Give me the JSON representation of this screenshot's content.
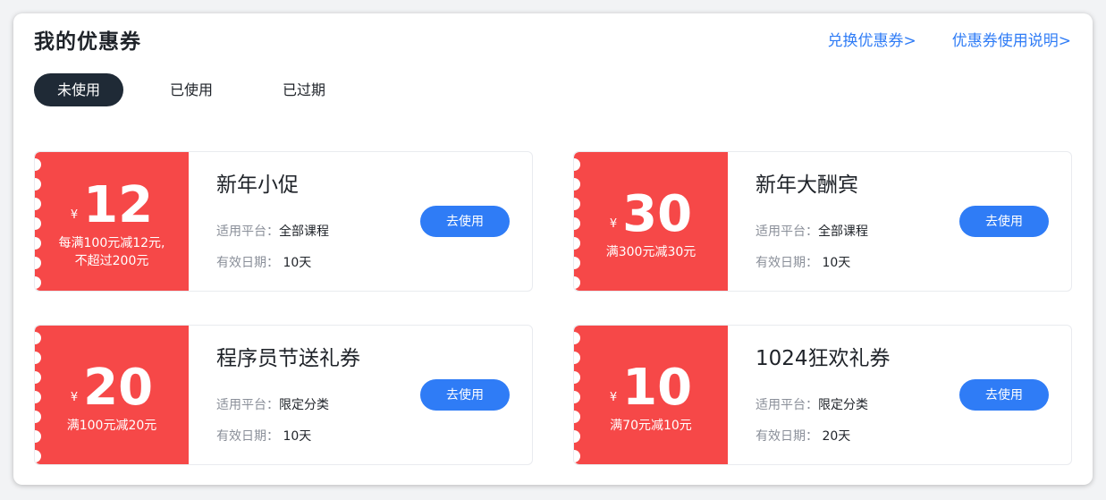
{
  "page": {
    "title": "我的优惠券",
    "links": {
      "redeem": "兑换优惠券>",
      "help": "优惠券使用说明>"
    }
  },
  "tabs": [
    {
      "label": "未使用",
      "active": true
    },
    {
      "label": "已使用",
      "active": false
    },
    {
      "label": "已过期",
      "active": false
    }
  ],
  "labels": {
    "platform": "适用平台：",
    "validity": "有效日期：",
    "currency": "¥",
    "use_button": "去使用"
  },
  "coupons": [
    {
      "name": "新年小促",
      "amount": "12",
      "rule_line1": "每满100元减12元,",
      "rule_line2": "不超过200元",
      "platform": "全部课程",
      "validity": "10天"
    },
    {
      "name": "新年大酬宾",
      "amount": "30",
      "rule_line1": "满300元减30元",
      "rule_line2": "",
      "platform": "全部课程",
      "validity": "10天"
    },
    {
      "name": "程序员节送礼券",
      "amount": "20",
      "rule_line1": "满100元减20元",
      "rule_line2": "",
      "platform": "限定分类",
      "validity": "10天"
    },
    {
      "name": "1024狂欢礼券",
      "amount": "10",
      "rule_line1": "满70元减10元",
      "rule_line2": "",
      "platform": "限定分类",
      "validity": "20天"
    }
  ],
  "colors": {
    "stub": "#f64848",
    "accent": "#2f7cf6",
    "active_tab": "#1f2a36"
  }
}
